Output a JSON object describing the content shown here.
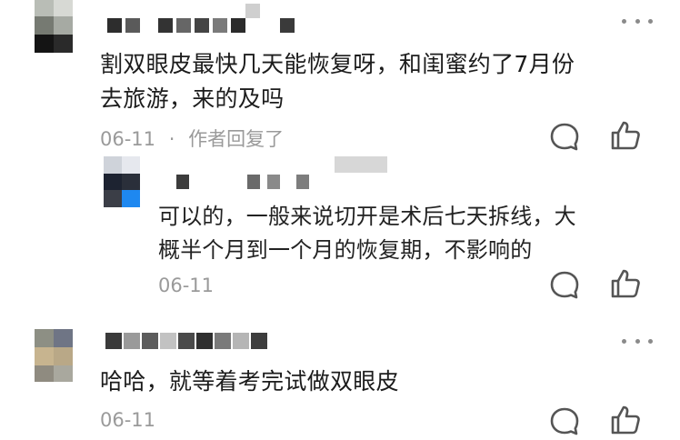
{
  "comments": [
    {
      "text_line1": "割双眼皮最快几天能恢复呀，和闺蜜约了7月份",
      "text_line2": "去旅游，来的及吗",
      "date": "06-11",
      "separator": "·",
      "author_replied": "作者回复了",
      "reply": {
        "text_line1": "可以的，一般来说切开是术后七天拆线，大",
        "text_line2": "概半个月到一个月的恢复期，不影响的",
        "date": "06-11"
      }
    },
    {
      "text_line1": "哈哈，就等着考完试做双眼皮",
      "date": "06-11"
    }
  ],
  "icons": {
    "more": "more-dots-icon",
    "comment": "comment-bubble-icon",
    "like": "thumbs-up-icon"
  },
  "colors": {
    "text": "#1c1c1c",
    "meta": "#9a9a9a",
    "icon": "#555555"
  }
}
